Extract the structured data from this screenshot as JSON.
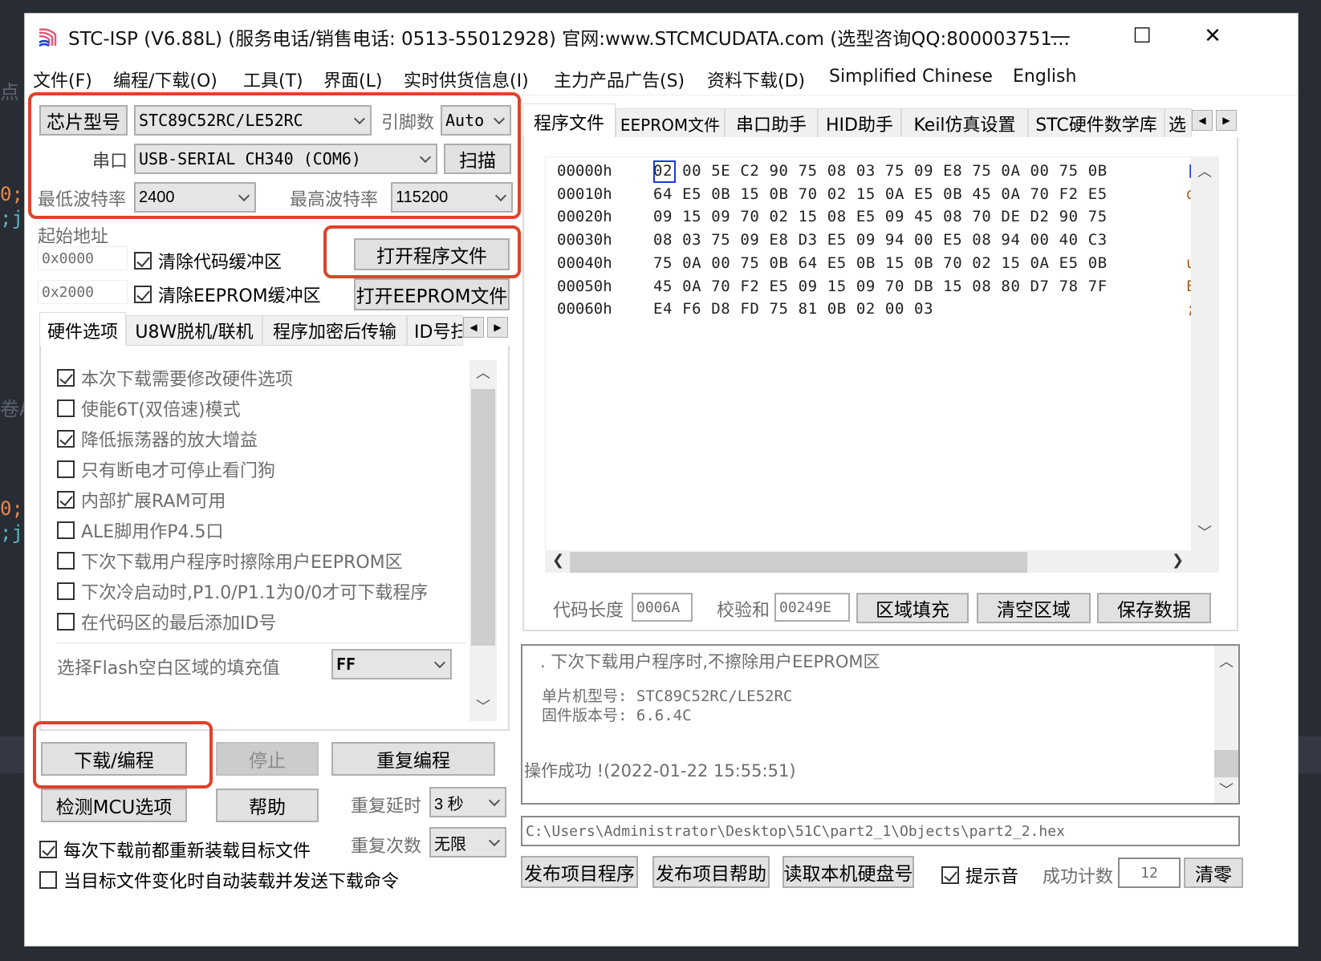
{
  "window": {
    "title": "STC-ISP (V6.88L) (服务电话/销售电话: 0513-55012928) 官网:www.STCMCUDATA.com  (选型咨询QQ:800003751...",
    "controls": {
      "minimize": "—",
      "maximize": "☐",
      "close": "✕"
    }
  },
  "menu": [
    "文件(F)",
    "编程/下载(O)",
    "工具(T)",
    "界面(L)",
    "实时供货信息(I)",
    "主力产品广告(S)",
    "资料下载(D)",
    "Simplified Chinese",
    "English"
  ],
  "chip": {
    "chip_button": "芯片型号",
    "chip_value": "STC89C52RC/LE52RC",
    "pins_label": "引脚数",
    "pins_value": "Auto",
    "port_label": "串口",
    "port_value": "USB-SERIAL CH340 (COM6)",
    "scan_button": "扫描",
    "min_baud_label": "最低波特率",
    "min_baud_value": "2400",
    "max_baud_label": "最高波特率",
    "max_baud_value": "115200"
  },
  "start_addr": {
    "label": "起始地址",
    "code_addr": "0x0000",
    "eeprom_addr": "0x2000",
    "clear_code": {
      "label": "清除代码缓冲区",
      "checked": true
    },
    "clear_eeprom": {
      "label": "清除EEPROM缓冲区",
      "checked": true
    },
    "open_program": "打开程序文件",
    "open_eeprom": "打开EEPROM文件"
  },
  "left_tabs": [
    "硬件选项",
    "U8W脱机/联机",
    "程序加密后传输",
    "ID号扫"
  ],
  "hardware_options": [
    {
      "label": "本次下载需要修改硬件选项",
      "checked": true
    },
    {
      "label": "使能6T(双倍速)模式",
      "checked": false
    },
    {
      "label": "降低振荡器的放大增益",
      "checked": true
    },
    {
      "label": "只有断电才可停止看门狗",
      "checked": false
    },
    {
      "label": "内部扩展RAM可用",
      "checked": true
    },
    {
      "label": "ALE脚用作P4.5口",
      "checked": false
    },
    {
      "label": "下次下载用户程序时擦除用户EEPROM区",
      "checked": false
    },
    {
      "label": "下次冷启动时,P1.0/P1.1为0/0才可下载程序",
      "checked": false
    },
    {
      "label": "在代码区的最后添加ID号",
      "checked": false
    }
  ],
  "flash_fill": {
    "label": "选择Flash空白区域的填充值",
    "value": "FF"
  },
  "actions": {
    "download": "下载/编程",
    "stop": "停止",
    "repeat": "重复编程",
    "detect": "检测MCU选项",
    "help": "帮助",
    "repeat_delay_label": "重复延时",
    "repeat_delay_value": "3 秒",
    "repeat_count_label": "重复次数",
    "repeat_count_value": "无限",
    "reload_before": {
      "label": "每次下载前都重新装载目标文件",
      "checked": true
    },
    "auto_load": {
      "label": "当目标文件变化时自动装载并发送下载命令",
      "checked": false
    }
  },
  "right_tabs": [
    "程序文件",
    "EEPROM文件",
    "串口助手",
    "HID助手",
    "Keil仿真设置",
    "STC硬件数学库",
    "选"
  ],
  "hex": {
    "rows": [
      {
        "addr": "00000h",
        "bytes": "02 00 5E C2 90 75 08 03 75 09 E8 75 0A 00 75 0B"
      },
      {
        "addr": "00010h",
        "bytes": "64 E5 0B 15 0B 70 02 15 0A E5 0B 45 0A 70 F2 E5"
      },
      {
        "addr": "00020h",
        "bytes": "09 15 09 70 02 15 08 E5 09 45 08 70 DE D2 90 75"
      },
      {
        "addr": "00030h",
        "bytes": "08 03 75 09 E8 D3 E5 09 94 00 E5 08 94 00 40 C3"
      },
      {
        "addr": "00040h",
        "bytes": "75 0A 00 75 0B 64 E5 0B 15 0B 70 02 15 0A E5 0B"
      },
      {
        "addr": "00050h",
        "bytes": "45 0A 70 F2 E5 09 15 09 70 DB 15 08 80 D7 78 7F"
      },
      {
        "addr": "00060h",
        "bytes": "E4 F6 D8 FD 75 81 0B 02 00 03"
      }
    ],
    "ascii_col": [
      "[",
      "d",
      "",
      "",
      "u",
      "E",
      ";"
    ],
    "code_len_label": "代码长度",
    "code_len": "0006A",
    "checksum_label": "校验和",
    "checksum": "00249E",
    "fill_button": "区域填充",
    "clear_button": "清空区域",
    "save_button": "保存数据"
  },
  "log": {
    "line1": ".  下次下载用户程序时,不擦除用户EEPROM区",
    "line2": "单片机型号: STC89C52RC/LE52RC",
    "line3": "固件版本号: 6.6.4C",
    "line4": "操作成功 !(2022-01-22 15:55:51)"
  },
  "file_path": "C:\\Users\\Administrator\\Desktop\\51C\\part2_1\\Objects\\part2_2.hex",
  "bottom": {
    "publish_program": "发布项目程序",
    "publish_help": "发布项目帮助",
    "read_disk": "读取本机硬盘号",
    "sound": {
      "label": "提示音",
      "checked": true
    },
    "success_label": "成功计数",
    "success_count": "12",
    "reset": "清零"
  },
  "editor_fragments": [
    "点",
    "0;",
    ";j",
    "卷A",
    "0;",
    ";j"
  ],
  "colors": {
    "highlight": "#e2412b",
    "accent_orange": "#e5894c",
    "accent_cyan": "#56b6c2",
    "selection": "#1a3bd6"
  }
}
